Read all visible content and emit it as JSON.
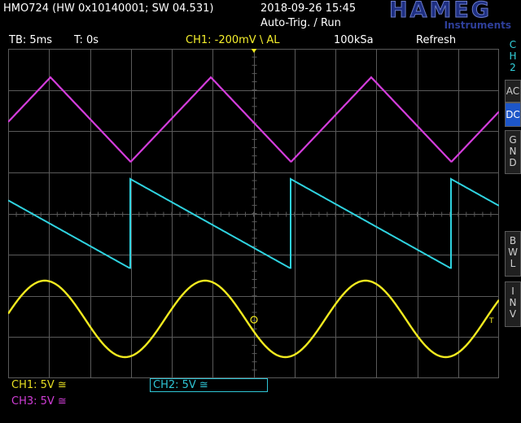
{
  "header": {
    "title": "HMO724 (HW 0x10140001; SW 04.531)",
    "datetime": "2018-09-26 15:45",
    "trigger_mode": "Auto-Trig. / Run",
    "logo_text": "HAMEG",
    "logo_sub": "Instruments"
  },
  "status": {
    "timebase": "TB: 5ms",
    "trigger_time": "T: 0s",
    "ch1_trigger": "CH1: -200mV \\ AL",
    "sample_rate": "100kSa",
    "acq_mode": "Refresh"
  },
  "side_menu": {
    "channel_tab": [
      "C",
      "H",
      "2"
    ],
    "ac": "AC",
    "dc": "DC",
    "gnd": [
      "G",
      "N",
      "D"
    ],
    "bwl": [
      "B",
      "W",
      "L"
    ],
    "inv": [
      "I",
      "N",
      "V"
    ]
  },
  "channels": {
    "ch1_scale": "CH1: 5V ≅",
    "ch2_scale": "CH2: 5V ≅",
    "ch3_scale": "CH3: 5V ≅"
  },
  "markers": {
    "ch1": "1",
    "ch2": "2",
    "ch3": "3"
  },
  "colors": {
    "ch1": "#f2ea1f",
    "ch2": "#2fd3e0",
    "ch3": "#d43ddc",
    "grid": "#5a5a5a",
    "dc_active": "#1d56c8"
  }
}
